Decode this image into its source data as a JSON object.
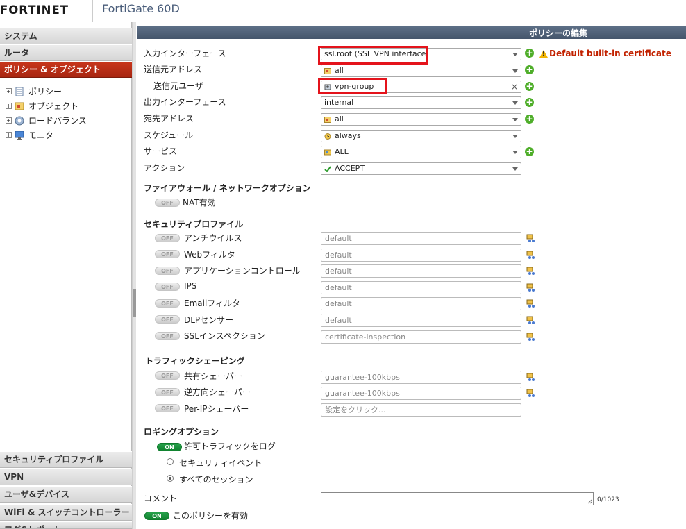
{
  "header": {
    "logo": "FORTINET",
    "device": "FortiGate 60D"
  },
  "sidebar": {
    "top_categories": [
      "システム",
      "ルータ",
      "ポリシー & オブジェクト"
    ],
    "tree": [
      "ポリシー",
      "オブジェクト",
      "ロードバランス",
      "モニタ"
    ],
    "bottom_categories": [
      "セキュリティプロファイル",
      "VPN",
      "ユーザ&デバイス",
      "WiFi & スイッチコントローラー",
      "ログ&レポート"
    ]
  },
  "page": {
    "title": "ポリシーの編集"
  },
  "form": {
    "incoming_interface": {
      "label": "入力インターフェース",
      "value": "ssl.root (SSL VPN interface)"
    },
    "warning": "Default built-in certificate",
    "source_address": {
      "label": "送信元アドレス",
      "value": "all"
    },
    "source_user": {
      "label": "送信元ユーザ",
      "value": "vpn-group"
    },
    "outgoing_interface": {
      "label": "出力インターフェース",
      "value": "internal"
    },
    "destination_address": {
      "label": "宛先アドレス",
      "value": "all"
    },
    "schedule": {
      "label": "スケジュール",
      "value": "always"
    },
    "service": {
      "label": "サービス",
      "value": "ALL"
    },
    "action": {
      "label": "アクション",
      "value": "ACCEPT"
    }
  },
  "firewall_section": {
    "title": "ファイアウォール / ネットワークオプション",
    "nat": {
      "label": "NAT有効",
      "state": "OFF"
    }
  },
  "security_section": {
    "title": "セキュリティプロファイル",
    "profiles": [
      {
        "label": "アンチウイルス",
        "state": "OFF",
        "value": "default"
      },
      {
        "label": "Webフィルタ",
        "state": "OFF",
        "value": "default"
      },
      {
        "label": "アプリケーションコントロール",
        "state": "OFF",
        "value": "default"
      },
      {
        "label": "IPS",
        "state": "OFF",
        "value": "default"
      },
      {
        "label": "Emailフィルタ",
        "state": "OFF",
        "value": "default"
      },
      {
        "label": "DLPセンサー",
        "state": "OFF",
        "value": "default"
      },
      {
        "label": "SSLインスペクション",
        "state": "OFF",
        "value": "certificate-inspection"
      }
    ]
  },
  "shaping_section": {
    "title": "トラフィックシェーピング",
    "items": [
      {
        "label": "共有シェーパー",
        "state": "OFF",
        "value": "guarantee-100kbps"
      },
      {
        "label": "逆方向シェーパー",
        "state": "OFF",
        "value": "guarantee-100kbps"
      },
      {
        "label": "Per-IPシェーパー",
        "state": "OFF",
        "value": "設定をクリック..."
      }
    ]
  },
  "logging_section": {
    "title": "ロギングオプション",
    "log_allowed": {
      "label": "許可トラフィックをログ",
      "state": "ON"
    },
    "options": [
      "セキュリティイベント",
      "すべてのセッション"
    ],
    "selected_index": 1
  },
  "comment": {
    "label": "コメント",
    "counter": "0/1023"
  },
  "enable_policy": {
    "label": "このポリシーを有効",
    "state": "ON"
  }
}
